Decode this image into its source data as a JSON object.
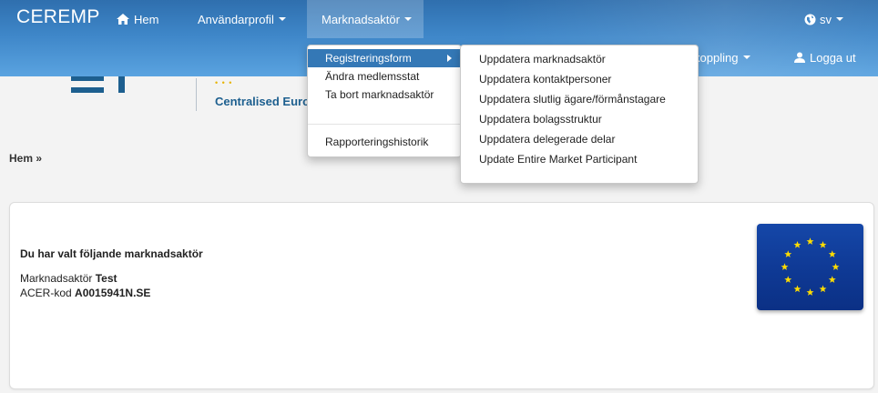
{
  "app": {
    "brand": "CEREMP"
  },
  "nav": {
    "home": "Hem",
    "user_profile": "Användarprofil",
    "market_actor": "Marknadsaktör",
    "language": "sv",
    "koppling": "koppling",
    "logout": "Logga ut"
  },
  "logo": {
    "text": "Centralised Euro"
  },
  "breadcrumb": "Hem »",
  "menu_primary": {
    "items": [
      "Registreringsform",
      "Ändra medlemsstat",
      "Ta bort marknadsaktör",
      "Rapporteringshistorik"
    ],
    "active": "Registreringsform"
  },
  "menu_sub": {
    "items": [
      "Uppdatera marknadsaktör",
      "Uppdatera kontaktpersoner",
      "Uppdatera slutlig ägare/förmånstagare",
      "Uppdatera bolagsstruktur",
      "Uppdatera delegerade delar",
      "Update Entire Market Participant"
    ]
  },
  "panel": {
    "heading": "Du har valt följande marknadsaktör",
    "actor_label": "Marknadsaktör",
    "actor_value": "Test",
    "acer_label": "ACER-kod",
    "acer_value": "A0015941N.SE"
  },
  "colors": {
    "nav_top": "#2f6fae",
    "nav_bottom": "#5aa3e0",
    "active_item": "#3478b6",
    "flag_blue": "#1547a8",
    "flag_star": "#ffdd00"
  },
  "icons": [
    "home-icon",
    "globe-icon",
    "user-icon",
    "eu-flag-icon"
  ]
}
